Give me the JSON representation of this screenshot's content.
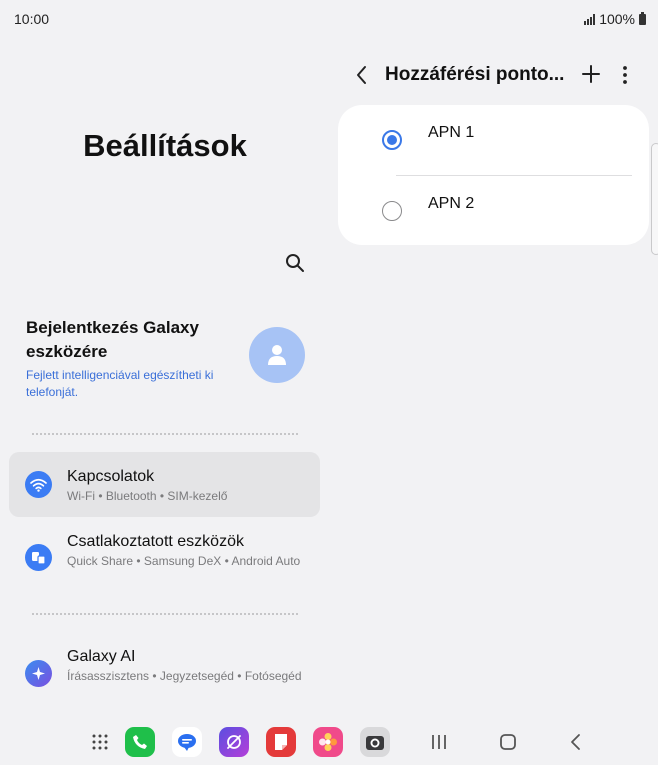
{
  "status_bar": {
    "time": "10:00",
    "battery": "100%"
  },
  "left_pane": {
    "title": "Beállítások",
    "account": {
      "title": "Bejelentkezés Galaxy eszközére",
      "subtitle": "Fejlett intelligenciával egészítheti ki telefonját."
    },
    "items": [
      {
        "title": "Kapcsolatok",
        "subtitle": "Wi-Fi • Bluetooth • SIM-kezelő",
        "icon": "wifi-icon",
        "color": "#3b7cf4"
      },
      {
        "title": "Csatlakoztatott eszközök",
        "subtitle": "Quick Share • Samsung DeX • Android Auto",
        "icon": "connected-devices-icon",
        "color": "#3b7cf4"
      },
      {
        "title": "Galaxy AI",
        "subtitle": "Írásasszisztens • Jegyzetsegéd • Fotósegéd",
        "icon": "galaxy-ai-icon",
        "color": "#6a4fe0"
      }
    ]
  },
  "right_pane": {
    "title": "Hozzáférési ponto...",
    "apns": [
      {
        "label": "APN 1",
        "selected": true
      },
      {
        "label": "APN 2",
        "selected": false
      }
    ]
  },
  "dock": {
    "apps": [
      "apps-grid-icon",
      "phone-app-icon",
      "messages-app-icon",
      "internet-app-icon",
      "notes-app-icon",
      "gallery-app-icon",
      "camera-app-icon"
    ],
    "nav": [
      "recents-button",
      "home-button",
      "back-button"
    ]
  },
  "colors": {
    "accent": "#3a78e8",
    "link": "#3a6fd8",
    "background": "#f2f2f4"
  }
}
